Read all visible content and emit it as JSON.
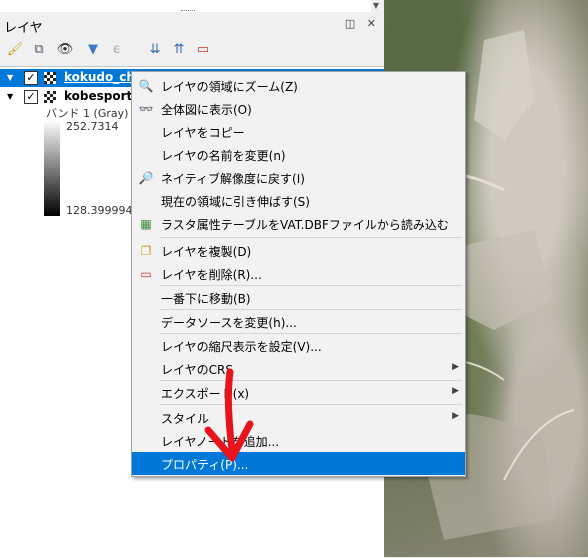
{
  "panel": {
    "title": "レイヤ",
    "window_buttons": "◫ ✕",
    "layers": [
      {
        "name": "kokudo_chiri",
        "checked": "✓"
      },
      {
        "name": "kobesport_b",
        "checked": "✓"
      }
    ],
    "band_label": "バンド 1 (Gray)",
    "ramp_max": "252.7314",
    "ramp_min": "128.399994"
  },
  "toolbar": {
    "icons": [
      "style-brush-icon",
      "add-group-icon",
      "visibility-icon",
      "filter-icon",
      "filter-legend-icon",
      "expand-all-icon",
      "collapse-all-icon",
      "remove-layer-icon"
    ]
  },
  "menu": {
    "items": [
      {
        "label": "レイヤの領域にズーム(Z)",
        "icon": "zoom-layer-icon"
      },
      {
        "label": "全体図に表示(O)",
        "icon": "overview-icon"
      },
      {
        "label": "レイヤをコピー",
        "icon": ""
      },
      {
        "label": "レイヤの名前を変更(n)",
        "icon": ""
      },
      {
        "label": "ネイティブ解像度に戻す(I)",
        "icon": "native-resolution-icon"
      },
      {
        "label": "現在の領域に引き伸ばす(S)",
        "icon": ""
      },
      {
        "label": "ラスタ属性テーブルをVAT.DBFファイルから読み込む",
        "icon": "raster-table-icon"
      },
      {
        "label": "レイヤを複製(D)",
        "icon": "duplicate-icon"
      },
      {
        "label": "レイヤを削除(R)...",
        "icon": "remove-icon"
      },
      {
        "label": "一番下に移動(B)",
        "icon": ""
      },
      {
        "label": "データソースを変更(h)...",
        "icon": ""
      },
      {
        "label": "レイヤの縮尺表示を設定(V)...",
        "icon": ""
      },
      {
        "label": "レイヤのCRS",
        "icon": ""
      },
      {
        "label": "エクスポート(x)",
        "icon": ""
      },
      {
        "label": "スタイル",
        "icon": ""
      },
      {
        "label": "レイヤノートを追加...",
        "icon": ""
      },
      {
        "label": "プロパティ(P)...",
        "icon": ""
      }
    ]
  }
}
